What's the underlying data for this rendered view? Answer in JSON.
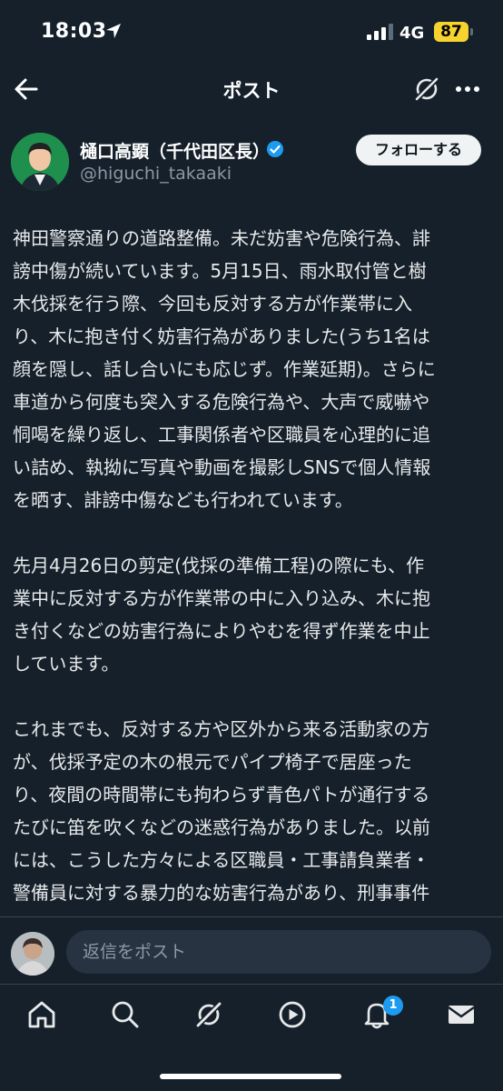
{
  "status_bar": {
    "time": "18:03",
    "network": "4G",
    "battery": "87"
  },
  "header": {
    "title": "ポスト"
  },
  "author": {
    "name": "樋口高顕（千代田区長）",
    "handle": "@higuchi_takaaki",
    "follow_label": "フォローする"
  },
  "post": {
    "paragraphs": [
      "神田警察通りの道路整備。未だ妨害や危険行為、誹\n謗中傷が続いています。5月15日、雨水取付管と樹\n木伐採を行う際、今回も反対する方が作業帯に入\nり、木に抱き付く妨害行為がありました(うち1名は\n顔を隠し、話し合いにも応じず。作業延期)。さらに\n車道から何度も突入する危険行為や、大声で威嚇や\n恫喝を繰り返し、工事関係者や区職員を心理的に追\nい詰め、執拗に写真や動画を撮影しSNSで個人情報\nを晒す、誹謗中傷なども行われています。",
      "先月4月26日の剪定(伐採の準備工程)の際にも、作\n業中に反対する方が作業帯の中に入り込み、木に抱\nき付くなどの妨害行為によりやむを得ず作業を中止\nしています。",
      "これまでも、反対する方や区外から来る活動家の方\nが、伐採予定の木の根元でパイプ椅子で居座った\nり、夜間の時間帯にも拘わらず青色パトが通行する\nたびに笛を吹くなどの迷惑行為がありました。以前\nには、こうした方々による区職員・工事請負業者・\n警備員に対する暴力的な妨害行為があり、刑事事件\nとなり書類送検されたこともあります。"
    ]
  },
  "reply": {
    "placeholder": "返信をポスト"
  },
  "tabbar": {
    "notifications_badge": "1"
  },
  "colors": {
    "background": "#15202b",
    "accent": "#1d9bf0",
    "battery": "#f7d330"
  }
}
